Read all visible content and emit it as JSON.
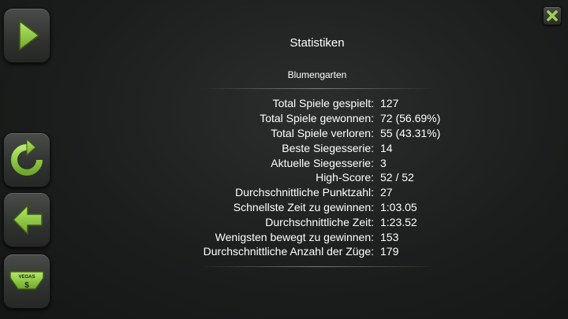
{
  "header": {
    "title": "Statistiken",
    "game_name": "Blumengarten"
  },
  "sidebar": {
    "buttons": [
      {
        "icon": "play-icon"
      },
      {
        "icon": "replay-icon"
      },
      {
        "icon": "back-arrow-icon"
      },
      {
        "icon": "vegas-icon"
      }
    ],
    "vegas_label": "VEGAS"
  },
  "close_icon": "close-icon",
  "colors": {
    "accent": "#8dc63f",
    "background": "#1e201f",
    "text": "#ffffff"
  },
  "stats": [
    {
      "label": "Total Spiele gespielt:",
      "value": "127"
    },
    {
      "label": "Total Spiele gewonnen:",
      "value": "72 (56.69%)"
    },
    {
      "label": "Total Spiele verloren:",
      "value": "55 (43.31%)"
    },
    {
      "label": "Beste Siegesserie:",
      "value": "14"
    },
    {
      "label": "Aktuelle Siegesserie:",
      "value": "3"
    },
    {
      "label": "High-Score:",
      "value": "52 / 52"
    },
    {
      "label": "Durchschnittliche Punktzahl:",
      "value": "27"
    },
    {
      "label": "Schnellste Zeit zu gewinnen:",
      "value": "1:03.05"
    },
    {
      "label": "Durchschnittliche Zeit:",
      "value": "1:23.52"
    },
    {
      "label": "Wenigsten bewegt zu gewinnen:",
      "value": "153"
    },
    {
      "label": "Durchschnittliche Anzahl der Züge:",
      "value": "179"
    }
  ]
}
